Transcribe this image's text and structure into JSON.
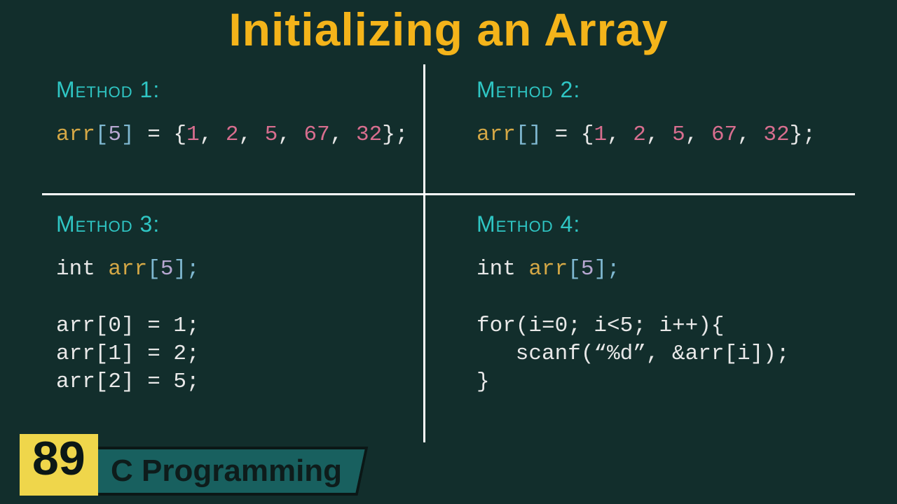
{
  "title": "Initializing an Array",
  "episode": "89",
  "course": "C Programming",
  "methods": {
    "m1": {
      "label": "Method 1:",
      "arr_name": "arr",
      "lbracket": "[",
      "size": "5",
      "rbracket": "]",
      "eq_open": " = {",
      "n1": "1",
      "c1": ", ",
      "n2": "2",
      "c2": ", ",
      "n3": "5",
      "c3": ", ",
      "n4": "67",
      "c4": ", ",
      "n5": "32",
      "close": "};"
    },
    "m2": {
      "label": "Method 2:",
      "arr_name": "arr",
      "lbracket": "[",
      "rbracket": "]",
      "eq_open": " = {",
      "n1": "1",
      "c1": ", ",
      "n2": "2",
      "c2": ", ",
      "n3": "5",
      "c3": ", ",
      "n4": "67",
      "c4": ", ",
      "n5": "32",
      "close": "};"
    },
    "m3": {
      "label": "Method 3:",
      "decl_kw": "int ",
      "decl_arr": "arr",
      "decl_lb": "[",
      "decl_sz": "5",
      "decl_rb": "];",
      "l1": "arr[0] = 1;",
      "l2": "arr[1] = 2;",
      "l3": "arr[2] = 5;"
    },
    "m4": {
      "label": "Method 4:",
      "decl_kw": "int ",
      "decl_arr": "arr",
      "decl_lb": "[",
      "decl_sz": "5",
      "decl_rb": "];",
      "for_line": "for(i=0; i<5; i++){",
      "scanf_line": "   scanf(“%d”, &arr[i]);",
      "end_brace": "}"
    }
  }
}
